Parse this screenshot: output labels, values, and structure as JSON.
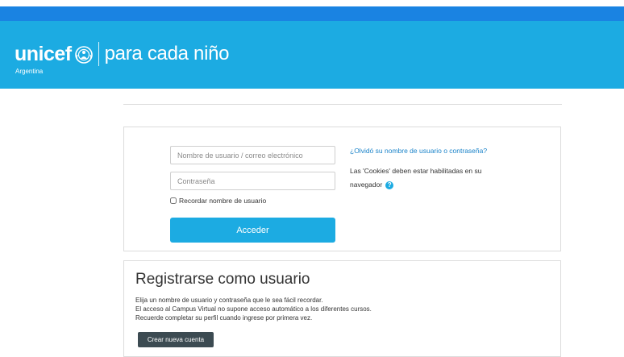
{
  "colors": {
    "top_bar": "#1a83e2",
    "header": "#1cabe2",
    "primary_button": "#1cabe2",
    "dark_button": "#3c4b52",
    "link": "#1a83c9"
  },
  "header": {
    "brand": "unicef",
    "logo_icon": "unicef-globe-icon",
    "tagline": "para cada niño",
    "country": "Argentina"
  },
  "login": {
    "username_placeholder": "Nombre de usuario / correo electrónico",
    "password_placeholder": "Contraseña",
    "remember_label": "Recordar nombre de usuario",
    "submit_label": "Acceder",
    "forgot_link": "¿Olvidó su nombre de usuario o contraseña?",
    "cookies_note": "Las 'Cookies' deben estar habilitadas en su navegador",
    "help_icon": "question-circle-icon"
  },
  "register": {
    "title": "Registrarse como usuario",
    "lines": [
      "Elija un nombre de usuario y contraseña que le sea fácil recordar.",
      "El acceso al Campus Virtual no supone acceso automático a los diferentes cursos.",
      "Recuerde completar su perfil cuando ingrese por primera vez."
    ],
    "button_label": "Crear nueva cuenta"
  }
}
